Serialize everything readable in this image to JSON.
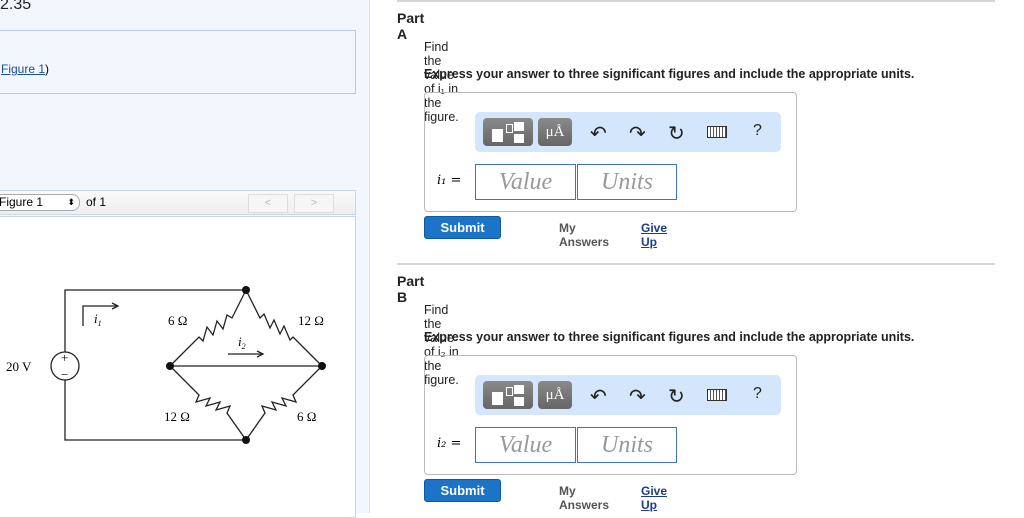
{
  "problem": {
    "title": "2.35",
    "figure_link": "Figure 1",
    "figure_link_close": ")"
  },
  "figure_nav": {
    "selected": "Figure 1",
    "of_label": "of 1",
    "prev": "<",
    "next": ">"
  },
  "circuit": {
    "source": "20 V",
    "plus": "+",
    "minus": "−",
    "r_top_left": "6 Ω",
    "r_top_right": "12 Ω",
    "r_bottom_left": "12 Ω",
    "r_bottom_right": "6 Ω",
    "i1": "i",
    "i1_sub": "1",
    "i2": "i",
    "i2_sub": "2"
  },
  "parts": [
    {
      "title": "Part A",
      "question": "Find the value of i₁ in the figure.",
      "instruction": "Express your answer to three significant figures and include the appropriate units.",
      "label": "i₁ =",
      "value_placeholder": "Value",
      "units_placeholder": "Units",
      "submit": "Submit",
      "my_answers": "My Answers",
      "give_up": "Give Up"
    },
    {
      "title": "Part B",
      "question": "Find the value of i₂ in the figure.",
      "instruction": "Express your answer to three significant figures and include the appropriate units.",
      "label": "i₂ =",
      "value_placeholder": "Value",
      "units_placeholder": "Units",
      "submit": "Submit",
      "my_answers": "My Answers",
      "give_up": "Give Up"
    }
  ],
  "toolbar": {
    "units_btn": "μÅ",
    "help": "?"
  }
}
